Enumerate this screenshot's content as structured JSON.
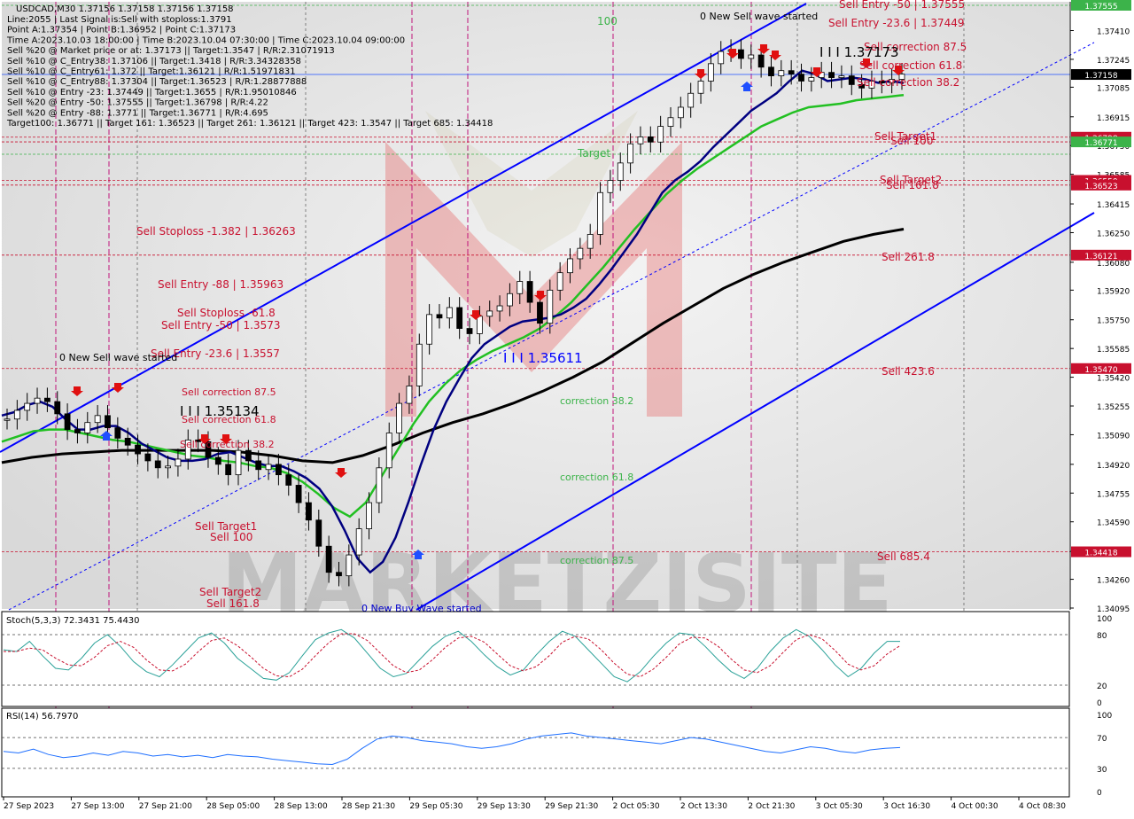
{
  "header": {
    "symbol_line": "USDCAD,M30  1.37156 1.37158 1.37156 1.37158",
    "info_lines": [
      "Line:2055 | Last Signal is:Sell with stoploss:1.3791",
      "Point A:1.37354 | Point B:1.36952 | Point C:1.37173",
      "Time A:2023.10.03 18:00:00 | Time B:2023.10.04 07:30:00 | Time C:2023.10.04 09:00:00",
      "Sell %20 @ Market price or at: 1.37173 || Target:1.3547 | R/R:2.31071913",
      "Sell %10 @ C_Entry38: 1.37106 || Target:1.3418 | R/R:3.34328358",
      "Sell %10 @ C_Entry61: 1.372 || Target:1.36121 | R/R:1.51971831",
      "Sell %10 @ C_Entry88: 1.37304 || Target:1.36523 | R/R:1.28877888",
      "Sell %10 @ Entry -23: 1.37449 || Target:1.3655 | R/R:1.95010846",
      "Sell %20 @ Entry -50: 1.37555 || Target:1.36798 | R/R:4.22",
      "Sell %20 @ Entry -88: 1.3771 || Target:1.36771 | R/R:4.695",
      "Target100: 1.36771 || Target 161: 1.36523 || Target 261: 1.36121 || Target 423: 1.3547 || Target 685: 1.34418"
    ]
  },
  "chart_data": {
    "type": "candlestick",
    "symbol": "USDCAD",
    "timeframe": "M30",
    "ylim": [
      1.34095,
      1.37555
    ],
    "price_ticks": [
      "1.37410",
      "1.37245",
      "1.37085",
      "1.36915",
      "1.36750",
      "1.36585",
      "1.36415",
      "1.36250",
      "1.36080",
      "1.35920",
      "1.35750",
      "1.35585",
      "1.35420",
      "1.35255",
      "1.35090",
      "1.34920",
      "1.34755",
      "1.34590",
      "1.34420",
      "1.34260",
      "1.34095"
    ],
    "time_labels": [
      "27 Sep 2023",
      "27 Sep 13:00",
      "27 Sep 21:00",
      "28 Sep 05:00",
      "28 Sep 13:00",
      "28 Sep 21:30",
      "29 Sep 05:30",
      "29 Sep 13:30",
      "29 Sep 21:30",
      "2 Oct 05:30",
      "2 Oct 13:30",
      "2 Oct 21:30",
      "3 Oct 05:30",
      "3 Oct 16:30",
      "4 Oct 00:30",
      "4 Oct 08:30"
    ],
    "current_price": "1.37158",
    "price_markers": [
      {
        "value": "1.37555",
        "color": "#3cb34a"
      },
      {
        "value": "1.37158",
        "color": "#000000"
      },
      {
        "value": "1.36798",
        "color": "#c8102e"
      },
      {
        "value": "1.36771",
        "color": "#3cb34a"
      },
      {
        "value": "1.36550",
        "color": "#c8102e"
      },
      {
        "value": "1.36523",
        "color": "#c8102e"
      },
      {
        "value": "1.36121",
        "color": "#c8102e"
      },
      {
        "value": "1.35470",
        "color": "#c8102e"
      },
      {
        "value": "1.34418",
        "color": "#c8102e"
      }
    ],
    "close_series": [
      1.3518,
      1.3523,
      1.3527,
      1.353,
      1.3528,
      1.3521,
      1.3512,
      1.351,
      1.3516,
      1.352,
      1.3513,
      1.3507,
      1.3503,
      1.3498,
      1.3494,
      1.349,
      1.3491,
      1.3495,
      1.3506,
      1.3505,
      1.3496,
      1.3492,
      1.3486,
      1.35,
      1.3494,
      1.3489,
      1.3492,
      1.3486,
      1.348,
      1.347,
      1.346,
      1.3445,
      1.343,
      1.3428,
      1.344,
      1.3455,
      1.347,
      1.349,
      1.351,
      1.3527,
      1.3537,
      1.3561,
      1.3578,
      1.3576,
      1.3582,
      1.357,
      1.3567,
      1.3577,
      1.358,
      1.3583,
      1.359,
      1.3597,
      1.3585,
      1.3573,
      1.3592,
      1.3602,
      1.361,
      1.3616,
      1.3624,
      1.3648,
      1.3655,
      1.3665,
      1.3676,
      1.368,
      1.3677,
      1.3686,
      1.3691,
      1.3697,
      1.3705,
      1.3712,
      1.3722,
      1.3729,
      1.373,
      1.3725,
      1.3727,
      1.372,
      1.3715,
      1.3718,
      1.3716,
      1.3712,
      1.3714,
      1.3717,
      1.3714,
      1.3715,
      1.371,
      1.3708,
      1.3712,
      1.3711,
      1.3713,
      1.3716
    ],
    "ma_fast_series": [
      1.352,
      1.3522,
      1.3526,
      1.3528,
      1.3525,
      1.3518,
      1.3512,
      1.3512,
      1.3514,
      1.3514,
      1.351,
      1.3504,
      1.35,
      1.3496,
      1.3494,
      1.3494,
      1.3495,
      1.3498,
      1.3499,
      1.3496,
      1.3493,
      1.3491,
      1.3491,
      1.3488,
      1.3484,
      1.3478,
      1.3468,
      1.3454,
      1.3438,
      1.343,
      1.3436,
      1.345,
      1.347,
      1.3492,
      1.3512,
      1.3528,
      1.3541,
      1.3553,
      1.3561,
      1.3566,
      1.3571,
      1.3574,
      1.3575,
      1.3576,
      1.3578,
      1.3582,
      1.3587,
      1.3595,
      1.3604,
      1.3614,
      1.3624,
      1.3636,
      1.3648,
      1.3655,
      1.366,
      1.3666,
      1.3674,
      1.3681,
      1.3688,
      1.3695,
      1.37,
      1.3705,
      1.3712,
      1.3718,
      1.3716,
      1.3712,
      1.3713,
      1.3714,
      1.3713,
      1.3711,
      1.3712,
      1.3711
    ],
    "ma_mid_series": [
      1.3505,
      1.3508,
      1.3511,
      1.3512,
      1.3512,
      1.351,
      1.3508,
      1.3506,
      1.3505,
      1.3503,
      1.3501,
      1.3499,
      1.3497,
      1.3496,
      1.3494,
      1.3493,
      1.3491,
      1.349,
      1.3487,
      1.3482,
      1.3475,
      1.3467,
      1.3462,
      1.347,
      1.3485,
      1.35,
      1.3515,
      1.3528,
      1.3538,
      1.3546,
      1.3552,
      1.3557,
      1.3561,
      1.3565,
      1.357,
      1.3577,
      1.3585,
      1.3595,
      1.3605,
      1.3616,
      1.3627,
      1.3637,
      1.3647,
      1.3655,
      1.3662,
      1.3668,
      1.3674,
      1.368,
      1.3686,
      1.369,
      1.3694,
      1.3697,
      1.3698,
      1.3699,
      1.3701,
      1.3702,
      1.3703,
      1.3704
    ],
    "ma_slow_series": [
      1.3493,
      1.3496,
      1.3498,
      1.3499,
      1.35,
      1.35,
      1.35,
      1.35,
      1.3499,
      1.3497,
      1.3494,
      1.3493,
      1.3497,
      1.3503,
      1.351,
      1.3516,
      1.3521,
      1.3527,
      1.3534,
      1.3542,
      1.3551,
      1.3562,
      1.3573,
      1.3583,
      1.3593,
      1.3601,
      1.3608,
      1.3614,
      1.362,
      1.3624,
      1.3627
    ]
  },
  "level_labels": {
    "sell_entry_50": "Sell Entry -50 | 1.37555",
    "sell_entry_23_top": "Sell Entry -23.6 | 1.37449",
    "sell_correction_875_top": "Sell correction 87.5",
    "sell_correction_618_top": "Sell correction 61.8",
    "sell_correction_382_top": "Sell correction 38.2",
    "sell_target1_top": "Sell Target1",
    "sell_100_top": "Sell 100",
    "sell_target2_top": "Sell Target2",
    "sell_1618_top": "Sell 161.8",
    "sell_2618": "Sell  261.8",
    "sell_4236": "Sell  423.6",
    "sell_6854": "Sell  685.4",
    "sell_stoploss_1382": "Sell Stoploss -1.382 | 1.36263",
    "sell_entry_88": "Sell Entry -88 | 1.35963",
    "sell_stoploss_618": "Sell Stoploss -61.8",
    "sell_entry_50_left": "Sell Entry -50 | 1.3573",
    "sell_entry_236_left": "Sell Entry -23.6 | 1.3557",
    "sell_correction_875_left": "Sell correction 87.5",
    "sell_correction_618_left": "Sell correction 61.8",
    "sell_correction_382_left": "Sell correction 38.2",
    "sell_target1_left": "Sell Target1",
    "sell_100_left": "Sell 100",
    "sell_target2_left": "Sell Target2",
    "sell_1618_left": "Sell 161.8",
    "correction_382": "correction 38.2",
    "correction_618": "correction 61.8",
    "correction_875": "correction 87.5",
    "new_sell_wave_top": "0 New Sell wave started",
    "new_sell_wave_left": "0 New Sell wave started",
    "new_buy_wave": "0 New Buy Wave started",
    "wave_label_top": "I I I 1.37173",
    "wave_label_mid": "I I I 1.35611",
    "wave_label_left": "I I I 1.35134",
    "label_100": "100",
    "label_target": "Target"
  },
  "stoch": {
    "title": "Stoch(5,3,3) 72.3431 75.4430",
    "levels": [
      "100",
      "80",
      "20",
      "0"
    ],
    "k": [
      62,
      60,
      72,
      55,
      40,
      38,
      52,
      70,
      80,
      66,
      48,
      36,
      30,
      44,
      60,
      76,
      82,
      70,
      52,
      40,
      28,
      26,
      35,
      55,
      74,
      82,
      86,
      76,
      58,
      40,
      30,
      34,
      50,
      66,
      78,
      84,
      72,
      56,
      42,
      32,
      38,
      56,
      72,
      84,
      78,
      62,
      46,
      30,
      24,
      36,
      54,
      70,
      82,
      80,
      66,
      50,
      36,
      28,
      40,
      60,
      76,
      86,
      78,
      62,
      44,
      30,
      40,
      58,
      72,
      72
    ],
    "d": [
      60,
      60,
      64,
      62,
      52,
      44,
      43,
      53,
      67,
      72,
      65,
      50,
      38,
      37,
      45,
      60,
      73,
      76,
      67,
      54,
      40,
      31,
      30,
      39,
      55,
      70,
      81,
      81,
      73,
      58,
      43,
      35,
      38,
      50,
      65,
      76,
      78,
      71,
      57,
      43,
      37,
      42,
      55,
      71,
      78,
      75,
      62,
      46,
      33,
      30,
      39,
      53,
      69,
      77,
      76,
      66,
      51,
      38,
      35,
      43,
      59,
      74,
      80,
      75,
      61,
      45,
      38,
      43,
      57,
      67
    ]
  },
  "rsi": {
    "title": "RSI(14) 56.7970",
    "levels": [
      "100",
      "70",
      "30",
      "0"
    ],
    "values": [
      52,
      50,
      55,
      48,
      44,
      46,
      50,
      47,
      52,
      50,
      46,
      48,
      45,
      47,
      44,
      48,
      46,
      45,
      42,
      40,
      38,
      36,
      35,
      42,
      56,
      68,
      72,
      70,
      66,
      64,
      62,
      58,
      56,
      58,
      62,
      68,
      72,
      74,
      76,
      72,
      70,
      68,
      66,
      64,
      62,
      66,
      70,
      68,
      64,
      60,
      56,
      52,
      50,
      54,
      58,
      56,
      52,
      50,
      54,
      56,
      57
    ]
  },
  "watermark": "MARKETZISITE",
  "colors": {
    "channel": "#0000ff",
    "ma_fast": "#000080",
    "ma_mid": "#22c022",
    "ma_slow": "#000000",
    "sell_level": "#c8102e",
    "green_level": "#3cb34a",
    "stoch_k": "#2aa198",
    "stoch_d": "#c8102e",
    "rsi_line": "#1e6fff",
    "vline": "#c0147a"
  }
}
